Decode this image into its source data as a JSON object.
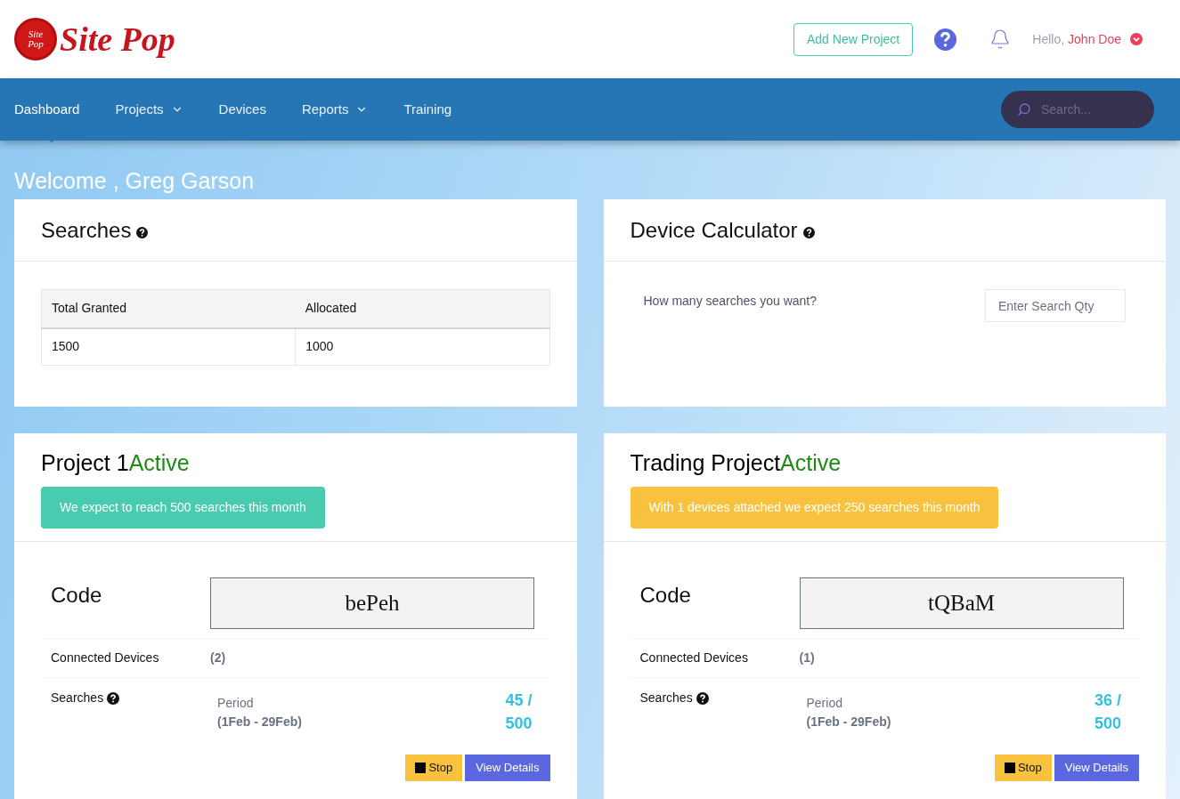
{
  "logo": {
    "badge_lines": [
      "Site",
      "Pop"
    ],
    "text": "Site Pop"
  },
  "header": {
    "add_button": "Add New Project",
    "greeting": "Hello,",
    "user_name": "John Doe"
  },
  "nav": {
    "items": [
      {
        "label": "Dashboard",
        "selected": true,
        "has_menu": false
      },
      {
        "label": "Projects",
        "selected": false,
        "has_menu": true
      },
      {
        "label": "Devices",
        "selected": false,
        "has_menu": false
      },
      {
        "label": "Reports",
        "selected": false,
        "has_menu": true
      },
      {
        "label": "Training",
        "selected": false,
        "has_menu": false
      }
    ],
    "search": {
      "placeholder": "Search..."
    }
  },
  "welcome": "Welcome , Greg Garson",
  "searches_card": {
    "title": "Searches",
    "table": {
      "columns": [
        "Total Granted",
        "Allocated"
      ],
      "rows": [
        [
          "1500",
          "1000"
        ]
      ]
    }
  },
  "calculator_card": {
    "title": "Device Calculator",
    "question": "How many searches you want?",
    "input": {
      "placeholder": "Enter Search Qty"
    }
  },
  "projects": [
    {
      "name": "Project 1",
      "status": "Active",
      "alert": {
        "kind": "success",
        "text": "We expect to reach 500 searches this month"
      },
      "code_label": "Code",
      "code": "bePeh",
      "devices_label": "Connected Devices",
      "devices": "(2)",
      "searches_label": "Searches",
      "period_label": "Period",
      "period": "(1Feb - 29Feb)",
      "used": "45 /",
      "limit": "500",
      "stop_button": "Stop",
      "details_button": "View Details"
    },
    {
      "name": "Trading Project",
      "status": "Active",
      "alert": {
        "kind": "warning",
        "text": "With 1 devices attached we expect 250 searches this month"
      },
      "code_label": "Code",
      "code": "tQBaM",
      "devices_label": "Connected Devices",
      "devices": "(1)",
      "searches_label": "Searches",
      "period_label": "Period",
      "period": "(1Feb - 29Feb)",
      "used": "36 /",
      "limit": "500",
      "stop_button": "Stop",
      "details_button": "View Details"
    }
  ]
}
